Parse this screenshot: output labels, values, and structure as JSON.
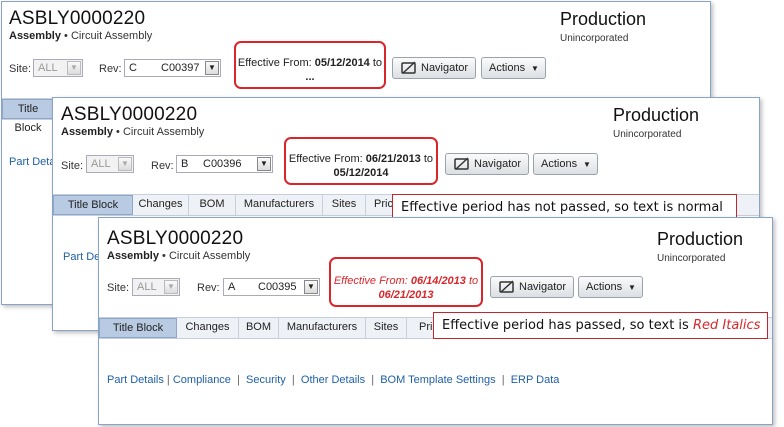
{
  "panels": [
    {
      "title": "ASBLY0000220",
      "subtitle_type": "Assembly",
      "subtitle_sep": "•",
      "subtitle_class": "Circuit Assembly",
      "lifecycle": "Production",
      "status": "Unincorporated",
      "site_label": "Site:",
      "site_value": "ALL",
      "rev_label": "Rev:",
      "rev_letter": "C",
      "rev_code": "C00397",
      "eff_prefix": "Effective From:",
      "eff_from": "05/12/2014",
      "eff_to_word": "to",
      "eff_to": "...",
      "navigator": "Navigator",
      "actions": "Actions",
      "tab_first": "Title Block",
      "link_fragment": "Part Detai"
    },
    {
      "title": "ASBLY0000220",
      "subtitle_type": "Assembly",
      "subtitle_sep": "•",
      "subtitle_class": "Circuit Assembly",
      "lifecycle": "Production",
      "status": "Unincorporated",
      "site_label": "Site:",
      "site_value": "ALL",
      "rev_label": "Rev:",
      "rev_letter": "B",
      "rev_code": "C00396",
      "eff_prefix": "Effective From:",
      "eff_from": "06/21/2013",
      "eff_to_word": "to",
      "eff_to": "05/12/2014",
      "navigator": "Navigator",
      "actions": "Actions",
      "tabs": [
        "Title Block",
        "Changes",
        "BOM",
        "Manufacturers",
        "Sites",
        "Pric"
      ],
      "link_fragment": "Part Det",
      "header_fragment": "..."
    },
    {
      "title": "ASBLY0000220",
      "subtitle_type": "Assembly",
      "subtitle_sep": "•",
      "subtitle_class": "Circuit Assembly",
      "lifecycle": "Production",
      "status": "Unincorporated",
      "site_label": "Site:",
      "site_value": "ALL",
      "rev_label": "Rev:",
      "rev_letter": "A",
      "rev_code": "C00395",
      "eff_prefix": "Effective From:",
      "eff_from": "06/14/2013",
      "eff_to_word": "to",
      "eff_to": "06/21/2013",
      "navigator": "Navigator",
      "actions": "Actions",
      "tabs": [
        "Title Block",
        "Changes",
        "BOM",
        "Manufacturers",
        "Sites",
        "Pric"
      ],
      "links": [
        "Part Details",
        "Compliance",
        "Security",
        "Other Details",
        "BOM Template Settings",
        "ERP Data"
      ],
      "link_sep": "|"
    }
  ],
  "callouts": {
    "normal": "Effective period has not passed, so text is normal",
    "passed_prefix": "Effective period has passed,  so text is",
    "passed_emphasis": "Red Italics"
  },
  "colors": {
    "highlight_border": "#d9262b",
    "past_effective_text": "#d9262b",
    "link": "#1f5fa8",
    "active_tab": "#b9cbe3"
  },
  "icons": {
    "navigator": "navigator-icon",
    "dropdown": "chevron-down-icon"
  }
}
